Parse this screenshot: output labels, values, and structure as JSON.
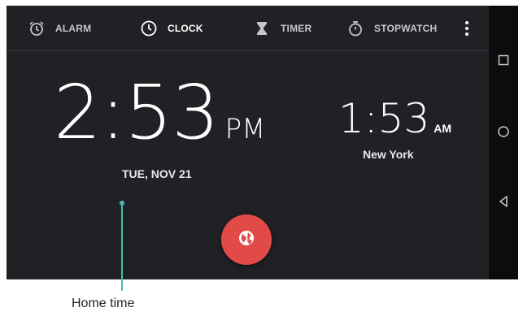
{
  "tabs": [
    {
      "label": "ALARM",
      "icon": "alarm-clock-icon",
      "active": false
    },
    {
      "label": "CLOCK",
      "icon": "clock-icon",
      "active": true
    },
    {
      "label": "TIMER",
      "icon": "hourglass-icon",
      "active": false
    },
    {
      "label": "STOPWATCH",
      "icon": "stopwatch-icon",
      "active": false
    }
  ],
  "overflow_icon": "more-vert-icon",
  "home": {
    "time": "2:53",
    "ampm": "PM",
    "date": "TUE, NOV 21"
  },
  "world_clock": {
    "time": "1:53",
    "ampm": "AM",
    "city": "New York"
  },
  "fab": {
    "icon": "globe-icon",
    "color": "#e24a47"
  },
  "nav_buttons": [
    "recent-apps-icon",
    "home-icon",
    "back-icon"
  ],
  "callout": {
    "text": "Home time",
    "color": "#4bb8b4"
  },
  "colors": {
    "background": "#202125",
    "navbar": "#0c0c0d"
  }
}
